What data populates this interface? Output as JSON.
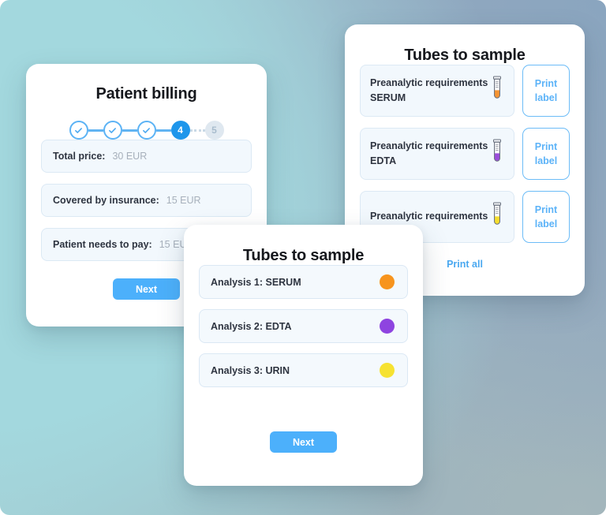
{
  "theme": {
    "accent": "#4cb0fb",
    "accent_dark": "#1e96eb",
    "step_done_border": "#5cb3f5",
    "step_future_bg": "#dfe8f0",
    "field_bg": "#f2f8fd",
    "field_border": "#dce9f4",
    "label_color": "#2e3440",
    "value_color": "#a7b0bb",
    "bg_gradient_from": "#9fd5dc",
    "bg_gradient_to": "#93a9bd"
  },
  "billing_card": {
    "title": "Patient billing",
    "stepper": {
      "total_steps": 5,
      "current_step": 4,
      "steps": [
        {
          "label": "1",
          "state": "done",
          "icon": "check-icon"
        },
        {
          "label": "2",
          "state": "done",
          "icon": "check-icon"
        },
        {
          "label": "3",
          "state": "done",
          "icon": "check-icon"
        },
        {
          "label": "4",
          "state": "current",
          "icon": ""
        },
        {
          "label": "5",
          "state": "future",
          "icon": ""
        }
      ]
    },
    "fields": [
      {
        "label": "Total price:",
        "value": "30 EUR"
      },
      {
        "label": "Covered by insurance:",
        "value": "15 EUR"
      },
      {
        "label": "Patient needs to pay:",
        "value": "15 EUR"
      }
    ],
    "next_label": "Next"
  },
  "tubes_back_card": {
    "title": "Tubes to sample",
    "rows": [
      {
        "requirement": "Preanalytic requirements",
        "sample_type": "SERUM",
        "tube_icon": "test-tube-icon",
        "tube_color": "#f59433",
        "print_label": "Print label"
      },
      {
        "requirement": "Preanalytic requirements",
        "sample_type": "EDTA",
        "tube_icon": "test-tube-icon",
        "tube_color": "#9b4ddb",
        "print_label": "Print label"
      },
      {
        "requirement": "Preanalytic requirements",
        "sample_type": "",
        "tube_icon": "test-tube-icon",
        "tube_color": "#f5de2e",
        "print_label": "Print label"
      }
    ],
    "print_all_label": "Print all"
  },
  "tubes_front_card": {
    "title": "Tubes to sample",
    "analyses": [
      {
        "label": "Analysis 1: SERUM",
        "color": "#f7941d"
      },
      {
        "label": "Analysis 2: EDTA",
        "color": "#8e44e0"
      },
      {
        "label": "Analysis 3: URIN",
        "color": "#f6e231"
      }
    ],
    "next_label": "Next"
  }
}
